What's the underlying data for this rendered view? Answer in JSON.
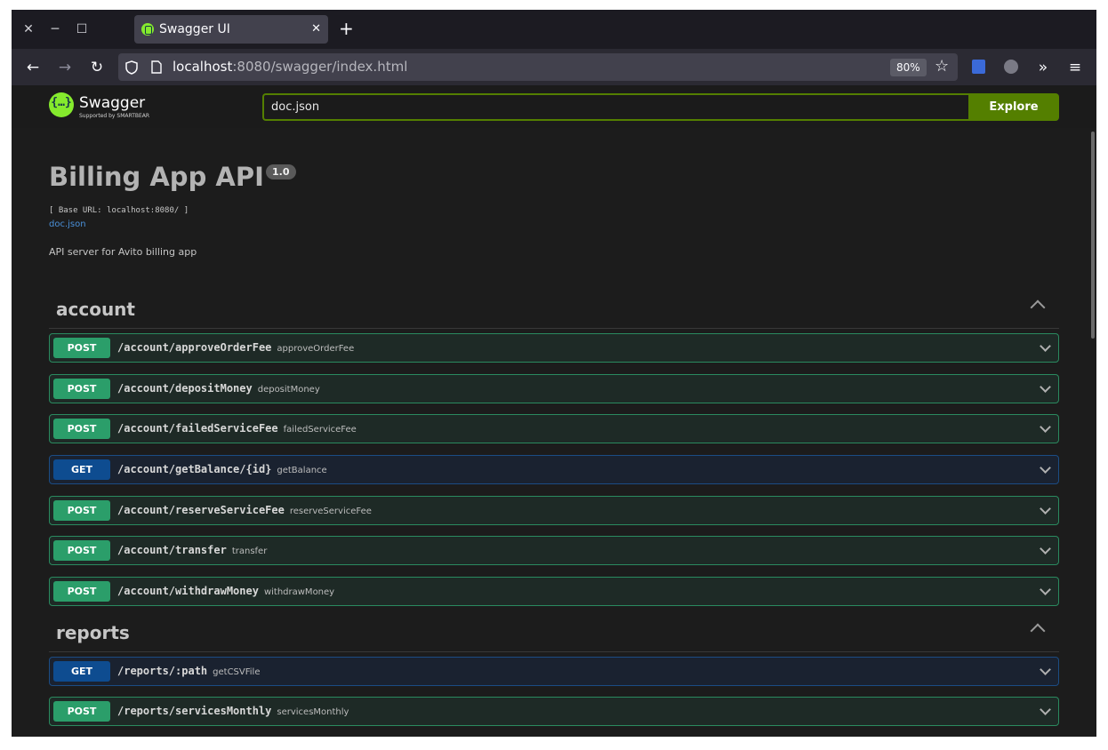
{
  "browser": {
    "tab_title": "Swagger UI",
    "url_host": "localhost",
    "url_rest": ":8080/swagger/index.html",
    "zoom": "80%"
  },
  "topbar": {
    "brand": "Swagger",
    "brand_sub": "Supported by SMARTBEAR",
    "spec_url": "doc.json",
    "explore_label": "Explore"
  },
  "info": {
    "title": "Billing App API",
    "version": "1.0",
    "base_url": "[ Base URL: localhost:8080/ ]",
    "spec_link": "doc.json",
    "description": "API server for Avito billing app"
  },
  "tags": [
    {
      "name": "account",
      "operations": [
        {
          "method": "POST",
          "path": "/account/approveOrderFee",
          "summary": "approveOrderFee"
        },
        {
          "method": "POST",
          "path": "/account/depositMoney",
          "summary": "depositMoney"
        },
        {
          "method": "POST",
          "path": "/account/failedServiceFee",
          "summary": "failedServiceFee"
        },
        {
          "method": "GET",
          "path": "/account/getBalance/{id}",
          "summary": "getBalance"
        },
        {
          "method": "POST",
          "path": "/account/reserveServiceFee",
          "summary": "reserveServiceFee"
        },
        {
          "method": "POST",
          "path": "/account/transfer",
          "summary": "transfer"
        },
        {
          "method": "POST",
          "path": "/account/withdrawMoney",
          "summary": "withdrawMoney"
        }
      ]
    },
    {
      "name": "reports",
      "operations": [
        {
          "method": "GET",
          "path": "/reports/:path",
          "summary": "getCSVFile"
        },
        {
          "method": "POST",
          "path": "/reports/servicesMonthly",
          "summary": "servicesMonthly"
        }
      ]
    }
  ]
}
